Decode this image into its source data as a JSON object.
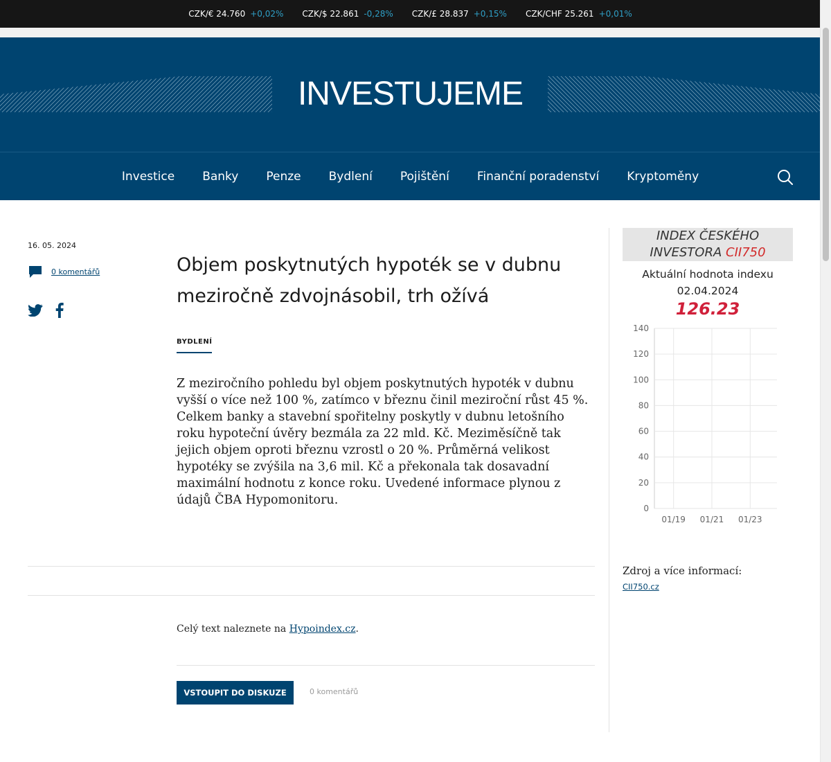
{
  "ticker": [
    {
      "pair": "CZK/€ 24.760",
      "change": "+0,02%"
    },
    {
      "pair": "CZK/$ 22.861",
      "change": "-0,28%"
    },
    {
      "pair": "CZK/£ 28.837",
      "change": "+0,15%"
    },
    {
      "pair": "CZK/CHF 25.261",
      "change": "+0,01%"
    }
  ],
  "site": {
    "logo": "INVESTUJEME"
  },
  "nav": {
    "items": [
      "Investice",
      "Banky",
      "Penze",
      "Bydlení",
      "Pojištění",
      "Finanční poradenství",
      "Kryptoměny"
    ],
    "search_icon": "search-icon"
  },
  "article": {
    "date": "16. 05. 2024",
    "comments_link": "0 komentářů",
    "title": "Objem poskytnutých hypoték se v dubnu meziročně zdvojnásobil, trh ožívá",
    "category": "BYDLENÍ",
    "lead": "Z meziročního pohledu byl objem poskytnutých hypoték v dubnu vyšší o více než 100 %, zatímco v březnu činil meziroční růst 45 %. Celkem banky a stavební spořitelny poskytly v dubnu letošního roku hypoteční úvěry bezmála za 22 mld. Kč. Meziměsíčně tak jejich objem oproti březnu vzrostl o 20 %. Průměrná velikost hypotéky se zvýšila na 3,6 mil. Kč a překonala tak dosavadní maximální hodnotu z konce roku. Uvedené informace plynou z údajů ČBA Hypomonitoru.",
    "source_prefix": "Celý text naleznete na",
    "source_link": "Hypoindex.cz",
    "source_suffix": ".",
    "discuss_button": "VSTOUPIT DO DISKUZE",
    "discuss_count": "0 komentářů"
  },
  "sidebar": {
    "index_title_line1": "INDEX ČESKÉHO",
    "index_title_line2_prefix": "INVESTORA",
    "index_code": "CII750",
    "current_label": "Aktuální hodnota indexu",
    "date": "02.04.2024",
    "value": "126.23",
    "source_label": "Zdroj a více informací:",
    "source_link": "CII750.cz"
  },
  "colors": {
    "brand": "#004470",
    "accent_red": "#d0203a",
    "ticker_change": "#2f9fc6"
  },
  "chart_data": {
    "type": "line",
    "x": [],
    "values": [],
    "x_tick_labels": [
      "01/19",
      "01/21",
      "01/23"
    ],
    "y_tick_labels": [
      "0",
      "20",
      "40",
      "60",
      "80",
      "100",
      "120",
      "140"
    ],
    "ylim": [
      0,
      140
    ],
    "grid": true,
    "title": "",
    "xlabel": "",
    "ylabel": ""
  }
}
